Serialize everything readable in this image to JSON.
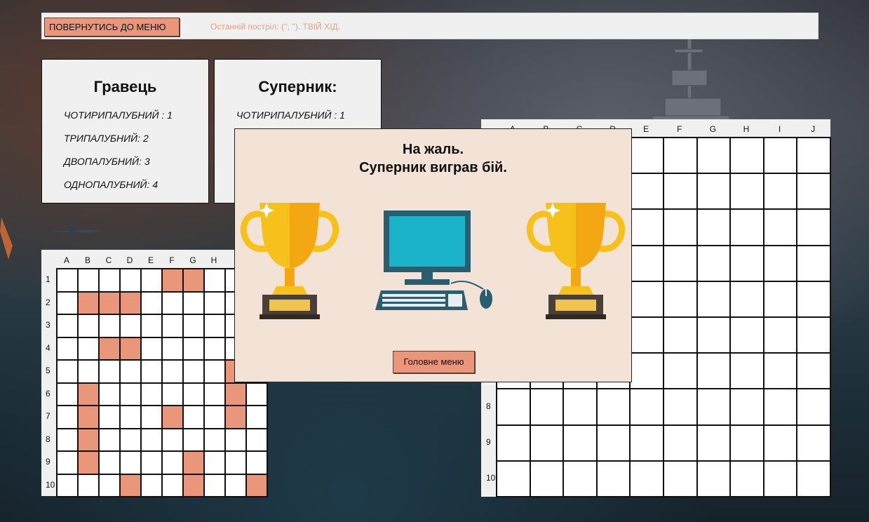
{
  "topbar": {
    "back_button_label": "ПОВЕРНУТИСЬ ДО МЕНЮ",
    "status_text": "Останній постріл: ('', '').  ТВІЙ ХІД."
  },
  "player_panel": {
    "title": "Гравець",
    "ships": [
      "ЧОТИРИПАЛУБНИЙ : 1",
      "ТРИПАЛУБНИЙ: 2",
      "ДВОПАЛУБНИЙ: 3",
      "ОДНОПАЛУБНИЙ: 4"
    ]
  },
  "opponent_panel": {
    "title": "Суперник:",
    "ships": [
      "ЧОТИРИПАЛУБНИЙ : 1"
    ]
  },
  "columns": [
    "A",
    "B",
    "C",
    "D",
    "E",
    "F",
    "G",
    "H",
    "I",
    "J"
  ],
  "rows": [
    "1",
    "2",
    "3",
    "4",
    "5",
    "6",
    "7",
    "8",
    "9",
    "10"
  ],
  "player_board": {
    "hit_cells": [
      [
        0,
        5
      ],
      [
        0,
        6
      ],
      [
        1,
        1
      ],
      [
        1,
        2
      ],
      [
        1,
        3
      ],
      [
        3,
        2
      ],
      [
        3,
        3
      ],
      [
        4,
        8
      ],
      [
        5,
        1
      ],
      [
        5,
        8
      ],
      [
        6,
        1
      ],
      [
        6,
        5
      ],
      [
        6,
        8
      ],
      [
        7,
        1
      ],
      [
        8,
        1
      ],
      [
        8,
        6
      ],
      [
        9,
        3
      ],
      [
        9,
        6
      ],
      [
        9,
        9
      ]
    ]
  },
  "opponent_board": {
    "hit_cells": []
  },
  "dialog": {
    "line1": "На жаль.",
    "line2": "Суперник виграв бій.",
    "button_label": "Головне меню"
  },
  "colors": {
    "accent": "#e9967a",
    "dialog_bg": "#f3e2d6",
    "panel_bg": "#f0f0f0"
  }
}
